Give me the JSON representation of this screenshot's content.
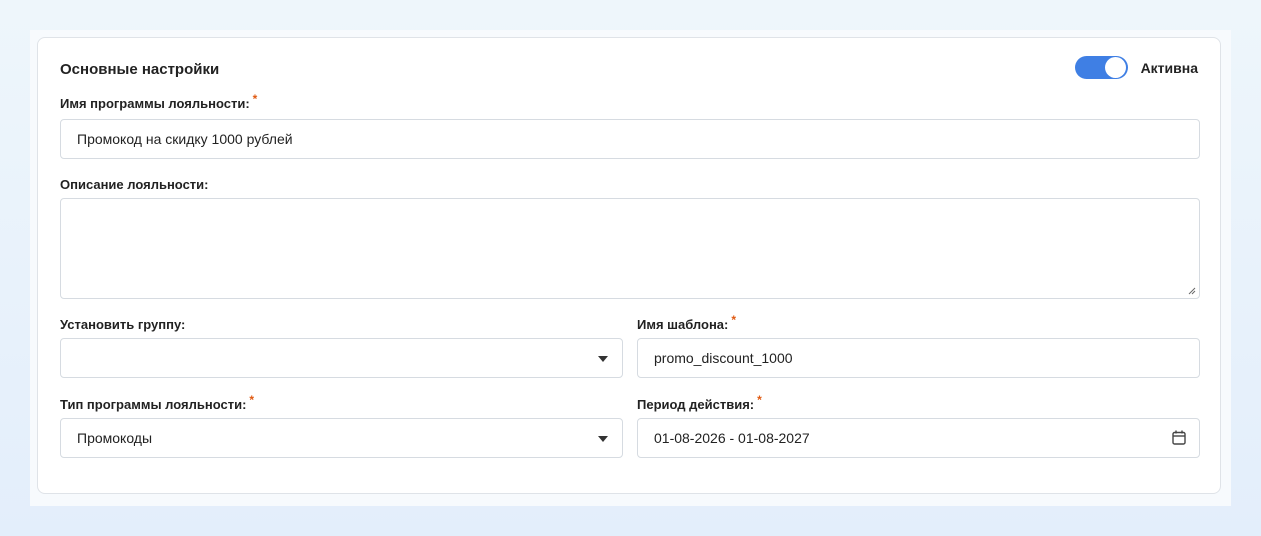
{
  "section": {
    "title": "Основные настройки",
    "active_label": "Активна",
    "active": true
  },
  "program_name": {
    "label": "Имя программы лояльности:",
    "required_mark": "*",
    "value": "Промокод на скидку 1000 рублей"
  },
  "description": {
    "label": "Описание лояльности:",
    "value": ""
  },
  "group": {
    "label": "Установить группу:",
    "value": ""
  },
  "template_name": {
    "label": "Имя шаблона:",
    "required_mark": "*",
    "value": "promo_discount_1000"
  },
  "program_type": {
    "label": "Тип программы лояльности:",
    "required_mark": "*",
    "value": "Промокоды"
  },
  "period": {
    "label": "Период действия:",
    "required_mark": "*",
    "value": "01-08-2026 - 01-08-2027"
  },
  "colors": {
    "toggle_on": "#3f7fe4",
    "required": "#e05a12",
    "border": "#d6dbe1"
  },
  "icons": {
    "dropdown": "caret-down-icon",
    "calendar": "calendar-icon",
    "resize": "resize-handle-icon"
  }
}
